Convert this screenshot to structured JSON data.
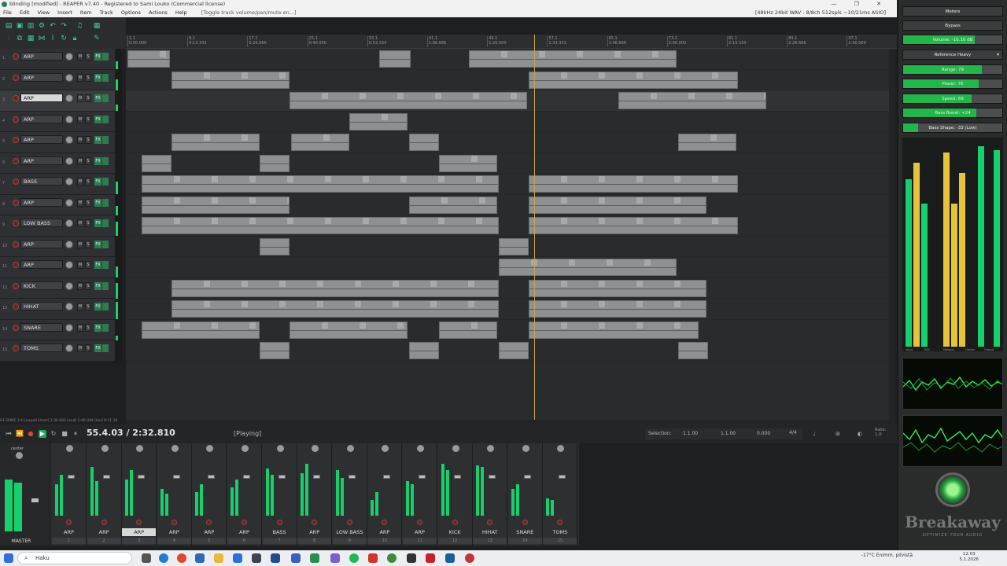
{
  "window": {
    "title": "blinding [modified] - REAPER v7.40 - Registered to Sami Louko (Commercial license)",
    "audio_info": "[48kHz 24bit WAV : 8/8ch 512spls ~10/21ms ASIO]",
    "controls": "— ❐ ✕"
  },
  "menu": {
    "items": [
      "File",
      "Edit",
      "View",
      "Insert",
      "Item",
      "Track",
      "Options",
      "Actions",
      "Help"
    ],
    "hint": "[Toggle track volume/pan/mute en...]"
  },
  "ruler": {
    "ticks": [
      "1.1",
      "9.1",
      "17.1",
      "25.1",
      "33.1",
      "41.1",
      "49.1",
      "57.1",
      "65.1",
      "73.1",
      "81.1",
      "89.1",
      "97.1"
    ],
    "times": [
      "0:00.000",
      "0:13.333",
      "0:26.666",
      "0:40.000",
      "0:53.333",
      "1:06.666",
      "1:20.000",
      "1:33.333",
      "1:46.666",
      "2:00.000",
      "2:13.333",
      "2:26.666",
      "2:40.000"
    ]
  },
  "tracks": [
    {
      "num": "1",
      "name": "ARP"
    },
    {
      "num": "2",
      "name": "ARP"
    },
    {
      "num": "3",
      "name": "ARP",
      "selected": true
    },
    {
      "num": "4",
      "name": "ARP"
    },
    {
      "num": "5",
      "name": "ARP"
    },
    {
      "num": "6",
      "name": "ARP"
    },
    {
      "num": "7",
      "name": "BASS"
    },
    {
      "num": "8",
      "name": "ARP"
    },
    {
      "num": "9",
      "name": "LOW BASS"
    },
    {
      "num": "10",
      "name": "ARP"
    },
    {
      "num": "11",
      "name": "ARP"
    },
    {
      "num": "12",
      "name": "KICK"
    },
    {
      "num": "13",
      "name": "HIHAT"
    },
    {
      "num": "14",
      "name": "SNARE"
    },
    {
      "num": "15",
      "name": "TOMS"
    }
  ],
  "track_buttons": {
    "mute": "M",
    "solo": "S",
    "fx": "FX"
  },
  "transport": {
    "position": "55.4.03 / 2:32.810",
    "state": "[Playing]",
    "status_line": "01-DUNE 3:4 Looped [start] 1:34.683 [end] 1:46.044 [len] 0:11.16",
    "selection_label": "Selection:",
    "selection_start": "1.1.00",
    "selection_end": "1.1.00",
    "selection_len": "0.000",
    "time_signature": "4/4",
    "rate_label": "Rate:",
    "rate_value": "1.0"
  },
  "mixer": {
    "master_label": "MASTER",
    "master_pan": "center",
    "strips": [
      {
        "name": "ARP",
        "num": "1"
      },
      {
        "name": "ARP",
        "num": "2"
      },
      {
        "name": "ARP",
        "num": "3",
        "selected": true
      },
      {
        "name": "ARP",
        "num": "4"
      },
      {
        "name": "ARP",
        "num": "5"
      },
      {
        "name": "ARP",
        "num": "6"
      },
      {
        "name": "BASS",
        "num": "7"
      },
      {
        "name": "ARP",
        "num": "8"
      },
      {
        "name": "LOW BASS",
        "num": "9"
      },
      {
        "name": "ARP",
        "num": "10"
      },
      {
        "name": "ARP",
        "num": "11"
      },
      {
        "name": "KICK",
        "num": "12"
      },
      {
        "name": "HIHAT",
        "num": "13"
      },
      {
        "name": "SNARE",
        "num": "14"
      },
      {
        "name": "TOMS",
        "num": "15"
      }
    ]
  },
  "plugin": {
    "meters_label": "Meters",
    "bypass_label": "Bypass",
    "volume": "Volume: -10.10 dB",
    "preset": "Reference Heavy",
    "range": "Range: 79",
    "power": "Power: 76",
    "speed": "Speed: 69",
    "bass_boost": "Bass Boost: +24",
    "bass_shape": "Bass Shape: -33 (Low)",
    "range_level": 0.79,
    "power_level": 0.76,
    "speed_level": 0.69,
    "boost_level": 0.74,
    "shape_level": 0.15,
    "volume_level": 0.72,
    "meter_labels": [
      "Input",
      "AGC",
      "Makeup",
      "Limiter",
      "Output"
    ],
    "brand": "Breakaway",
    "tagline": "OPTIMIZE YOUR AUDIO"
  },
  "taskbar": {
    "search_placeholder": "Haku",
    "weather": "-17°C  Enimm. pilvistä",
    "time": "12.03",
    "date": "5.1.2026"
  }
}
